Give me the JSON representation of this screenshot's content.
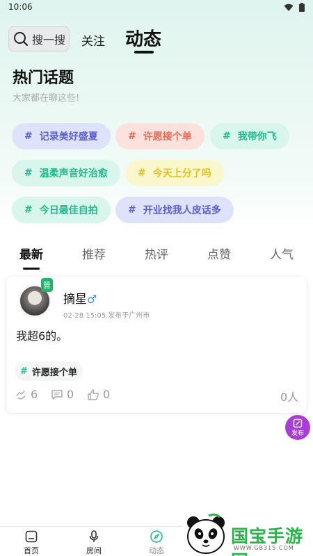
{
  "status": {
    "time": "10:06"
  },
  "header": {
    "search_placeholder": "搜一搜",
    "tab_follow": "关注",
    "tab_dynamic": "动态"
  },
  "hot_topics": {
    "title": "热门话题",
    "subtitle": "大家都在聊这些!",
    "hash": "#",
    "chips": [
      {
        "label": "记录美好盛夏",
        "bg": "#dfe2fb",
        "fg": "#5a5fd6"
      },
      {
        "label": "许愿接个单",
        "bg": "#fde1dc",
        "fg": "#ee6a55"
      },
      {
        "label": "我带你飞",
        "bg": "#d8f6ec",
        "fg": "#23b88e"
      },
      {
        "label": "温柔声音好治愈",
        "bg": "#d8f6ec",
        "fg": "#23b88e"
      },
      {
        "label": "今天上分了吗",
        "bg": "#fbf7cc",
        "fg": "#e1c21a"
      },
      {
        "label": "今日最佳自拍",
        "bg": "#d8f6ec",
        "fg": "#23b88e"
      },
      {
        "label": "开业找我人皮话多",
        "bg": "#dfe2fb",
        "fg": "#5a5fd6"
      }
    ]
  },
  "feed_tabs": [
    "最新",
    "推荐",
    "热评",
    "点赞",
    "人气"
  ],
  "post": {
    "badge": "管",
    "username": "摘星",
    "gender_symbol": "♂",
    "meta": "02-28 15:05 发布于广州市",
    "content": "我超6的。",
    "topic_hash": "#",
    "topic": "许愿接个单",
    "gifts": "6",
    "comments": "0",
    "likes": "0",
    "views": "0人"
  },
  "publish_label": "发布",
  "bottom_nav": {
    "home": "首页",
    "room": "房间",
    "dynamic": "动态"
  },
  "watermark": {
    "text": "国宝手游网",
    "url": "WWW.GB315.COM"
  },
  "colors": {
    "accent_green": "#23b88e",
    "publish_purple": "#a93ed6"
  }
}
